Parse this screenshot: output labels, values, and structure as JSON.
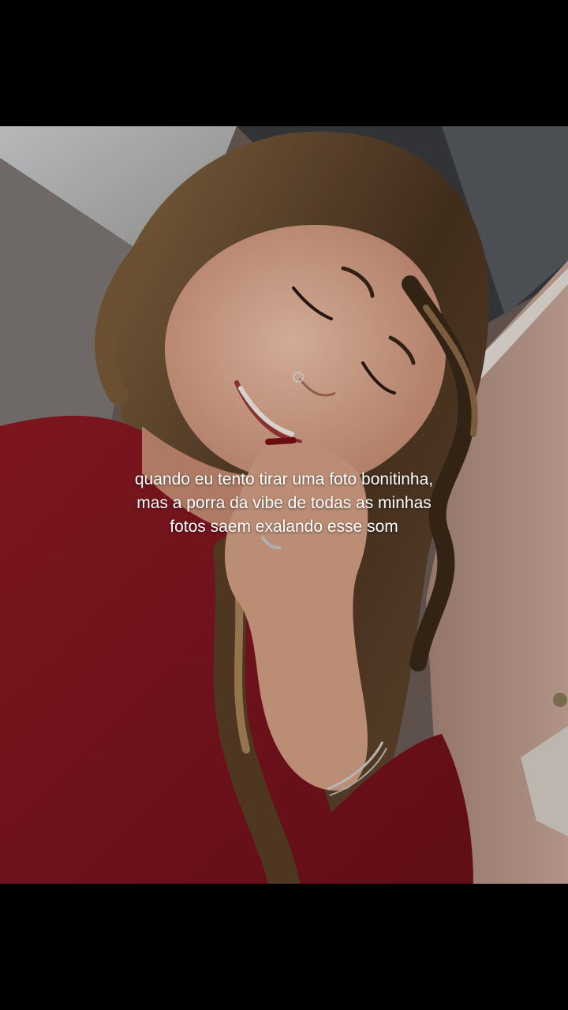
{
  "caption": {
    "lines": [
      "quando eu tento tirar uma foto bonitinha,",
      "mas a porra da vibe de todas as minhas",
      "fotos saem exalando esse som"
    ]
  },
  "colors": {
    "background": "#000000",
    "caption_text": "#ffffff",
    "sweater": "#8a1620",
    "hair": "#6b4a2c",
    "skin": "#d9a48a",
    "wall": "#c7a595"
  }
}
